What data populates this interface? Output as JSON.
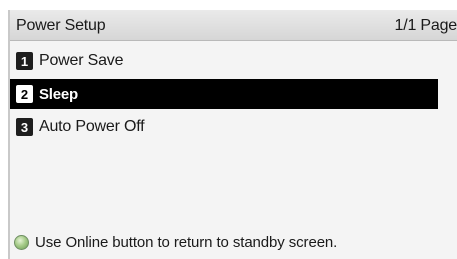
{
  "header": {
    "title": "Power Setup",
    "page_indicator": "1/1 Page"
  },
  "menu": {
    "items": [
      {
        "number": "1",
        "label": "Power Save",
        "selected": false
      },
      {
        "number": "2",
        "label": "Sleep",
        "selected": true
      },
      {
        "number": "3",
        "label": "Auto Power Off",
        "selected": false
      }
    ]
  },
  "footer": {
    "icon": "online-button-icon",
    "hint": "Use Online button to return to standby screen."
  },
  "colors": {
    "selection_background": "#000000",
    "selection_text": "#ffffff",
    "online_indicator": "#a7cc8a"
  }
}
